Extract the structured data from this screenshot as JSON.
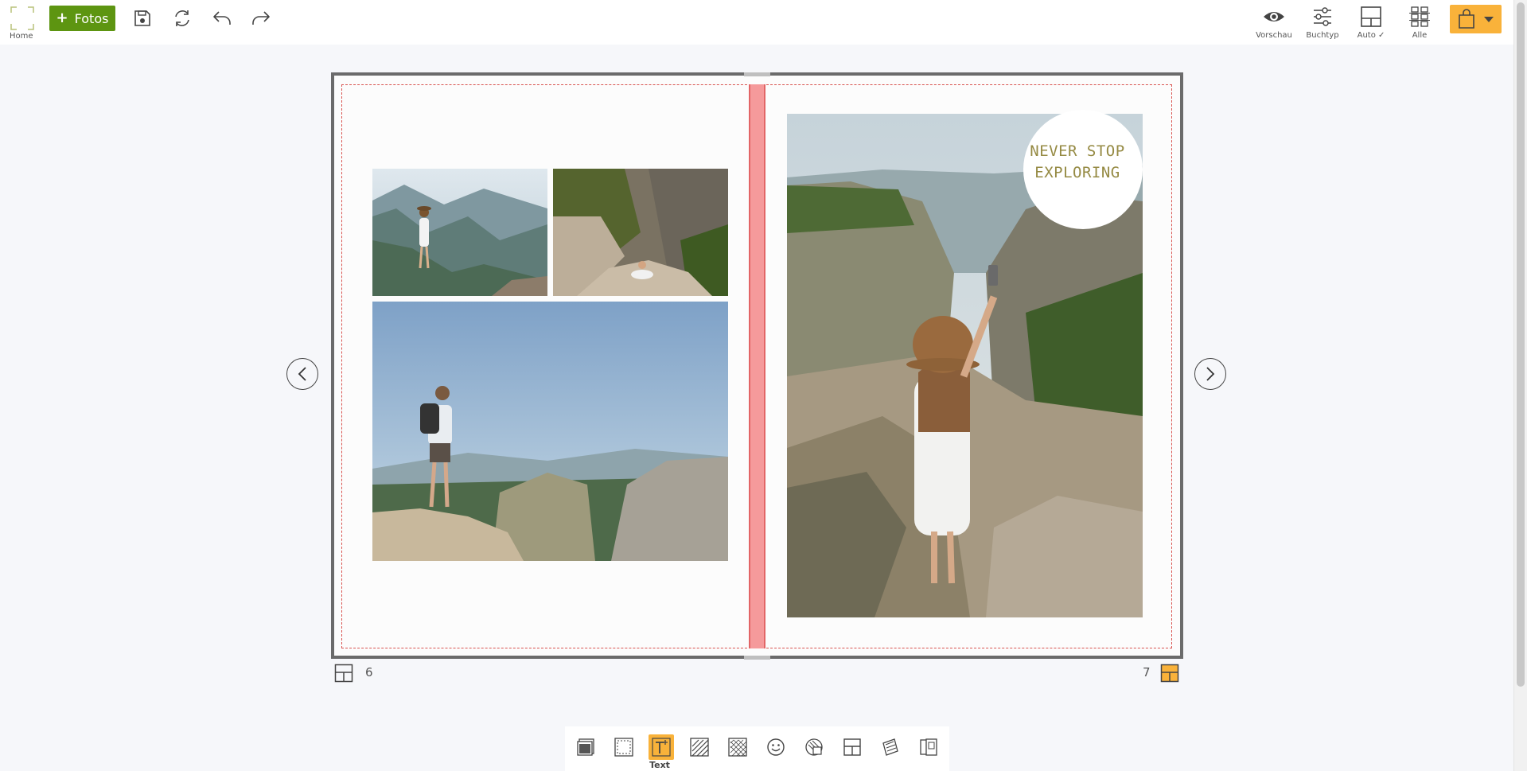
{
  "topbar": {
    "home_label": "Home",
    "add_photos_label": "Fotos",
    "tools_right": [
      {
        "label": "Vorschau",
        "icon": "eye-icon"
      },
      {
        "label": "Buchtyp",
        "icon": "sliders-icon"
      },
      {
        "label": "Auto ✓",
        "icon": "layout-icon"
      },
      {
        "label": "Alle",
        "icon": "grid-icon"
      }
    ],
    "cart_icon": "shopping-bag-icon"
  },
  "book": {
    "text_block": "NEVER STOP\nEXPLORING",
    "left_page_number": "6",
    "right_page_number": "7"
  },
  "bottom_toolbar": {
    "active_tool_label": "Text",
    "tools": [
      "photo-frame-icon",
      "select-frame-icon",
      "text-icon",
      "background-pattern-icon",
      "texture-icon",
      "emoji-icon",
      "mask-icon",
      "layout-icon",
      "clipart-icon",
      "pages-icon"
    ]
  },
  "colors": {
    "accent": "#f9b23a",
    "fotos_button": "#5d9511",
    "safe_area": "#d9534f",
    "spine": "#f59a9b",
    "text_color": "#958a43"
  }
}
